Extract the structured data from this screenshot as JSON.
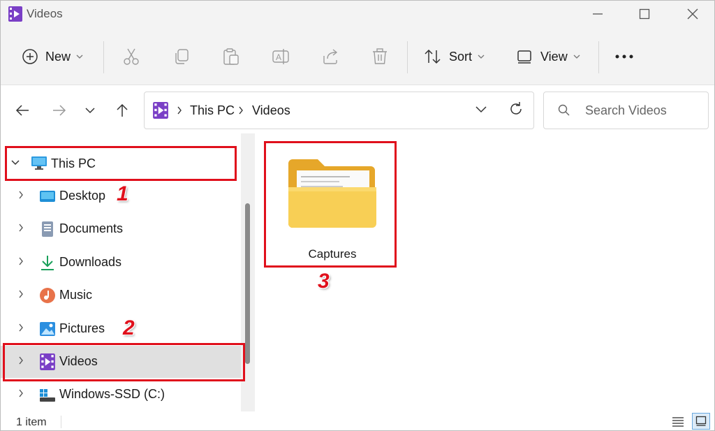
{
  "window": {
    "title": "Videos"
  },
  "toolbar": {
    "new_label": "New",
    "sort_label": "Sort",
    "view_label": "View"
  },
  "address": {
    "crumbs": [
      "This PC",
      "Videos"
    ]
  },
  "search": {
    "placeholder": "Search Videos"
  },
  "nav": {
    "root_label": "This PC",
    "items": [
      {
        "label": "Desktop",
        "icon": "desktop-icon"
      },
      {
        "label": "Documents",
        "icon": "documents-icon"
      },
      {
        "label": "Downloads",
        "icon": "downloads-icon"
      },
      {
        "label": "Music",
        "icon": "music-icon"
      },
      {
        "label": "Pictures",
        "icon": "pictures-icon"
      },
      {
        "label": "Videos",
        "icon": "videos-icon",
        "selected": true
      },
      {
        "label": "Windows-SSD (C:)",
        "icon": "drive-icon"
      }
    ]
  },
  "content": {
    "folders": [
      {
        "name": "Captures"
      }
    ]
  },
  "annotations": {
    "step1": "1",
    "step2": "2",
    "step3": "3"
  },
  "status": {
    "item_count": "1 item"
  },
  "colors": {
    "highlight_red": "#e0101c",
    "selection": "#e0e0e0",
    "folder": "#f5c242"
  }
}
